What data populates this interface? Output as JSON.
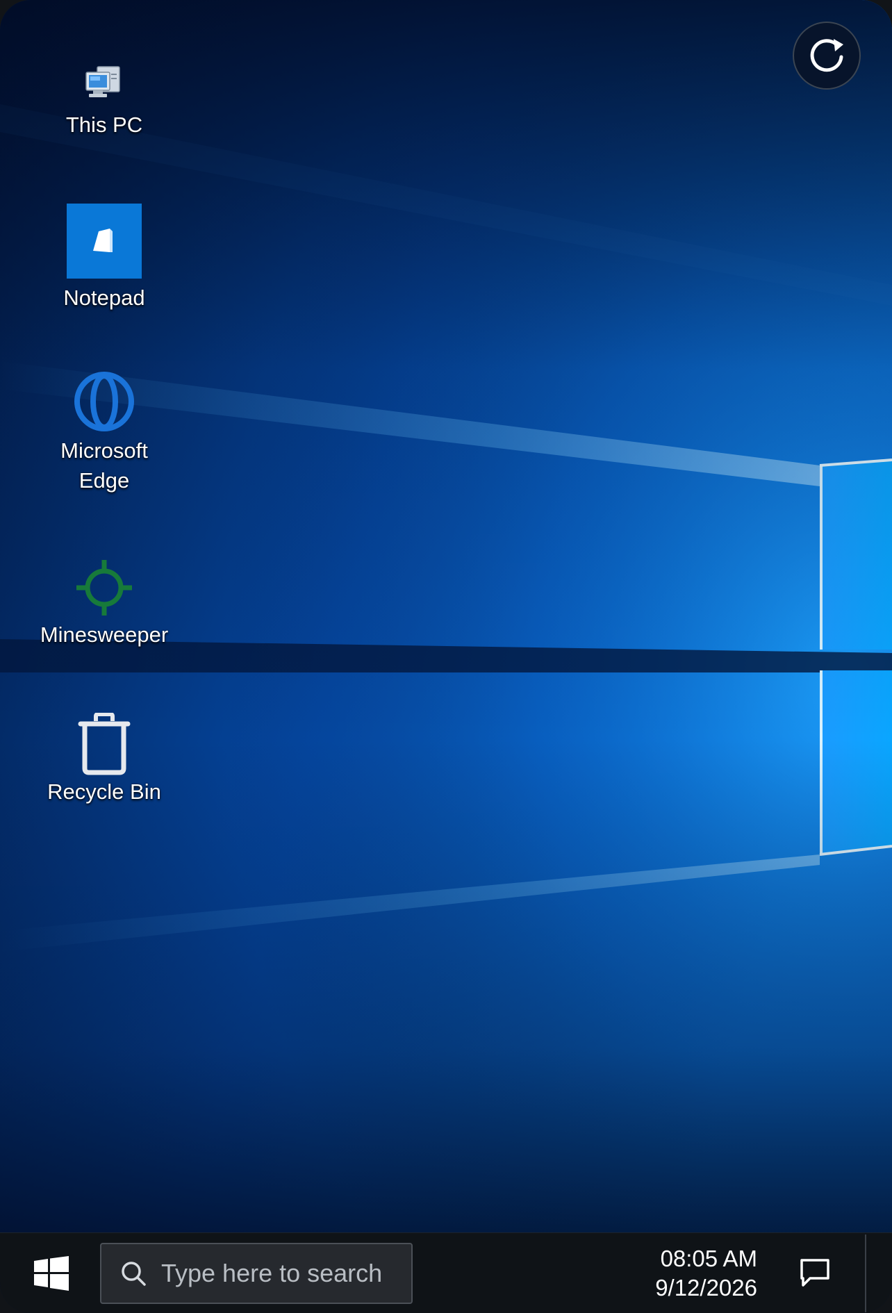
{
  "desktop": {
    "icons": [
      {
        "label": "This PC",
        "icon": "computer-icon"
      },
      {
        "label": "Notepad",
        "icon": "notepad-icon"
      },
      {
        "label_line1": "Microsoft",
        "label_line2": "Edge",
        "icon": "edge-icon"
      },
      {
        "label": "Minesweeper",
        "icon": "crosshair-icon"
      },
      {
        "label": "Recycle Bin",
        "icon": "recycle-bin-icon"
      }
    ],
    "refresh_icon": "refresh-icon"
  },
  "taskbar": {
    "start_icon": "windows-logo-icon",
    "search": {
      "placeholder": "Type here to search",
      "icon": "search-icon"
    },
    "clock": {
      "time": "08:05 AM",
      "date": "9/12/2026"
    },
    "notification_icon": "chat-bubble-icon"
  },
  "colors": {
    "wallpaper_dark": "#02143a",
    "wallpaper_bright": "#0a7fe0",
    "notepad_tile": "#0a78d7",
    "edge_blue": "#1a73d9",
    "minesweeper_green": "#177a3a",
    "taskbar": "#0f1317"
  }
}
